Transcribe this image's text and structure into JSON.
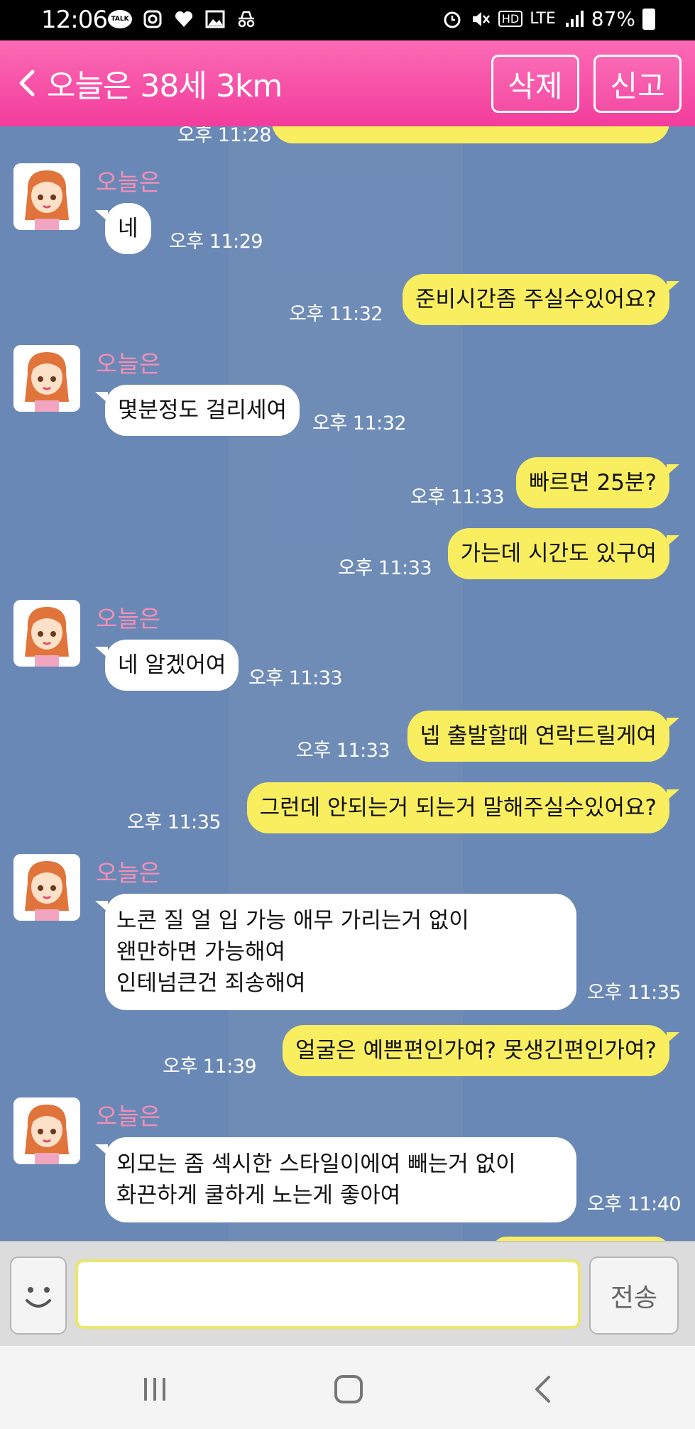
{
  "status_bar": {
    "time": "12:06",
    "talk_label": "TALK",
    "network": "LTE",
    "battery": "87%"
  },
  "header": {
    "title": "오늘은 38세 3km",
    "delete_label": "삭제",
    "report_label": "신고"
  },
  "chat": {
    "partial_timestamp": "오후 11:28",
    "messages": [
      {
        "dir": "in",
        "sender": "오늘은",
        "lines": [
          "네"
        ],
        "time": "오후 11:29"
      },
      {
        "dir": "out",
        "lines": [
          "준비시간좀 주실수있어요?"
        ],
        "time": "오후 11:32"
      },
      {
        "dir": "in",
        "sender": "오늘은",
        "lines": [
          "몇분정도 걸리세여"
        ],
        "time": "오후 11:32"
      },
      {
        "dir": "out",
        "lines": [
          "빠르면 25분?"
        ],
        "time": "오후 11:33"
      },
      {
        "dir": "out",
        "lines": [
          "가는데 시간도 있구여"
        ],
        "time": "오후 11:33"
      },
      {
        "dir": "in",
        "sender": "오늘은",
        "lines": [
          "네 알겠어여"
        ],
        "time": "오후 11:33"
      },
      {
        "dir": "out",
        "lines": [
          "넵 출발할때 연락드릴게여"
        ],
        "time": "오후 11:33"
      },
      {
        "dir": "out",
        "lines": [
          "그런데 안되는거 되는거 말해주실수있어요?"
        ],
        "time": "오후 11:35"
      },
      {
        "dir": "in",
        "sender": "오늘은",
        "lines": [
          "노콘 질 얼 입 가능 애무 가리는거 없이",
          "왠만하면 가능해여",
          "인테넘큰건 죄송해여"
        ],
        "time": "오후 11:35"
      },
      {
        "dir": "out",
        "lines": [
          "얼굴은 예쁜편인가여? 못생긴편인가여?"
        ],
        "time": "오후 11:39"
      },
      {
        "dir": "in",
        "sender": "오늘은",
        "lines": [
          "외모는 좀 섹시한 스타일이에여 빼는거 없이",
          "화끈하게 쿨하게 노는게 좋아여"
        ],
        "time": "오후 11:40"
      }
    ]
  },
  "input": {
    "value": "",
    "placeholder": "",
    "send_label": "전송"
  },
  "colors": {
    "header_pink": "#f33c9c",
    "chat_bg": "#6a88b5",
    "out_bubble": "#f9ee5f",
    "sender_name": "#f390b8"
  },
  "icons": {
    "emoji": "smiley-icon",
    "back": "chevron-left-icon",
    "nav_recent": "recent-apps-icon",
    "nav_home": "home-icon",
    "nav_back": "back-icon"
  }
}
